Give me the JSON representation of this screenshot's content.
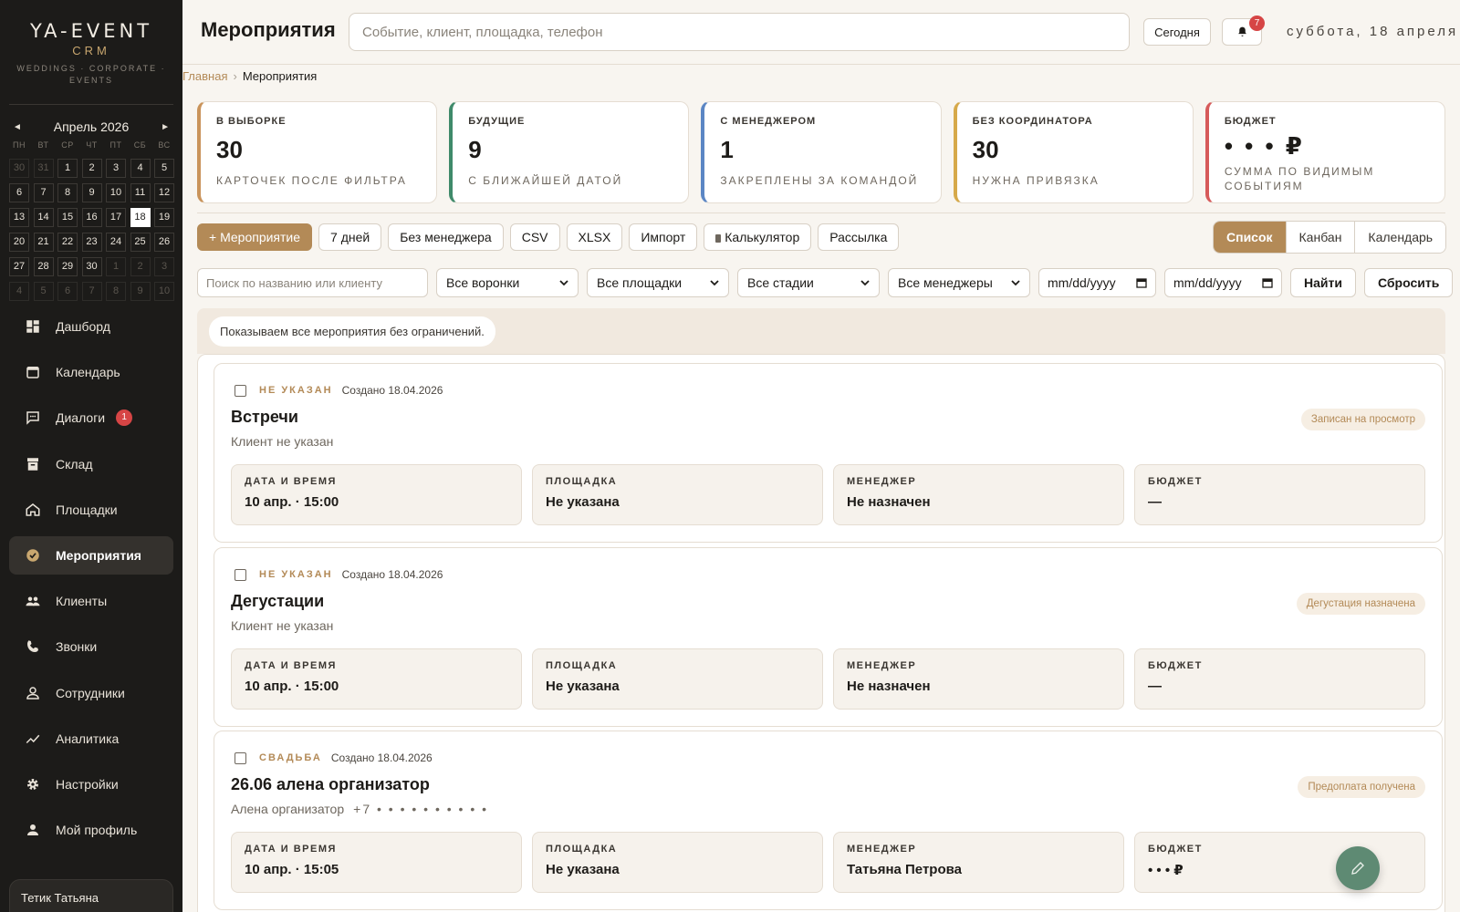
{
  "brand": {
    "name": "YA-EVENT",
    "sub": "CRM",
    "tagline": "WEDDINGS · CORPORATE · EVENTS"
  },
  "calendar": {
    "month": "Апрель 2026",
    "prev": "◄",
    "next": "►",
    "weekdays": [
      "ПН",
      "ВТ",
      "СР",
      "ЧТ",
      "ПТ",
      "СБ",
      "ВС"
    ],
    "weeks": [
      [
        "30",
        "31",
        "1",
        "2",
        "3",
        "4",
        "5"
      ],
      [
        "6",
        "7",
        "8",
        "9",
        "10",
        "11",
        "12"
      ],
      [
        "13",
        "14",
        "15",
        "16",
        "17",
        "18",
        "19"
      ],
      [
        "20",
        "21",
        "22",
        "23",
        "24",
        "25",
        "26"
      ],
      [
        "27",
        "28",
        "29",
        "30",
        "1",
        "2",
        "3"
      ],
      [
        "4",
        "5",
        "6",
        "7",
        "8",
        "9",
        "10"
      ]
    ]
  },
  "nav": [
    {
      "label": "Дашборд",
      "icon": "dashboard-icon"
    },
    {
      "label": "Календарь",
      "icon": "calendar-icon"
    },
    {
      "label": "Диалоги",
      "icon": "chat-icon",
      "badge": "1"
    },
    {
      "label": "Склад",
      "icon": "warehouse-icon"
    },
    {
      "label": "Площадки",
      "icon": "home-icon"
    },
    {
      "label": "Мероприятия",
      "icon": "check-circle-icon",
      "active": true
    },
    {
      "label": "Клиенты",
      "icon": "people-icon"
    },
    {
      "label": "Звонки",
      "icon": "phone-icon"
    },
    {
      "label": "Сотрудники",
      "icon": "person-outline-icon"
    },
    {
      "label": "Аналитика",
      "icon": "trend-icon"
    },
    {
      "label": "Настройки",
      "icon": "gear-icon"
    },
    {
      "label": "Мой профиль",
      "icon": "person-icon"
    }
  ],
  "user": {
    "name": "Тетик Татьяна"
  },
  "header": {
    "title": "Мероприятия",
    "search_placeholder": "Событие, клиент, площадка, телефон",
    "today": "Сегодня",
    "notifications": "7",
    "date": "суббота, 18 апреля"
  },
  "breadcrumb": {
    "home": "Главная",
    "sep": "›",
    "current": "Мероприятия"
  },
  "stats": [
    {
      "label": "В ВЫБОРКЕ",
      "value": "30",
      "sub": "КАРТОЧЕК ПОСЛЕ ФИЛЬТРА",
      "color": "#c9935a"
    },
    {
      "label": "БУДУЩИЕ",
      "value": "9",
      "sub": "С БЛИЖАЙШЕЙ ДАТОЙ",
      "color": "#3f8a6a"
    },
    {
      "label": "С МЕНЕДЖЕРОМ",
      "value": "1",
      "sub": "ЗАКРЕПЛЕНЫ ЗА КОМАНДОЙ",
      "color": "#5b86c4"
    },
    {
      "label": "БЕЗ КООРДИНАТОРА",
      "value": "30",
      "sub": "НУЖНА ПРИВЯЗКА",
      "color": "#d6a94a"
    },
    {
      "label": "БЮДЖЕТ",
      "value": "• • • ₽",
      "sub": "СУММА ПО ВИДИМЫМ СОБЫТИЯМ",
      "color": "#d65a5a"
    }
  ],
  "actions": {
    "add": "+ Мероприятие",
    "days7": "7 дней",
    "no_manager": "Без менеджера",
    "csv": "CSV",
    "xlsx": "XLSX",
    "import": "Импорт",
    "calculator": "Калькулятор",
    "mailing": "Рассылка"
  },
  "views": {
    "list": "Список",
    "kanban": "Канбан",
    "calendar": "Календарь"
  },
  "filters": {
    "search_placeholder": "Поиск по названию или клиенту",
    "funnels": "Все воронки",
    "venues": "Все площадки",
    "stages": "Все стадии",
    "managers": "Все менеджеры",
    "date_from": "mm/dd/yyyy",
    "date_to": "mm/dd/yyyy",
    "find": "Найти",
    "reset": "Сбросить"
  },
  "notice": "Показываем все мероприятия без ограничений.",
  "labels": {
    "datetime": "ДАТА И ВРЕМЯ",
    "venue": "ПЛОЩАДКА",
    "manager": "МЕНЕДЖЕР",
    "budget": "БЮДЖЕТ"
  },
  "events": [
    {
      "type": "НЕ УКАЗАН",
      "created": "Создано 18.04.2026",
      "title": "Встречи",
      "client": "Клиент не указан",
      "phone": "",
      "stage": "Записан на просмотр",
      "datetime": "10 апр. · 15:00",
      "venue": "Не указана",
      "manager": "Не назначен",
      "budget": "—"
    },
    {
      "type": "НЕ УКАЗАН",
      "created": "Создано 18.04.2026",
      "title": "Дегустации",
      "client": "Клиент не указан",
      "phone": "",
      "stage": "Дегустация назначена",
      "datetime": "10 апр. · 15:00",
      "venue": "Не указана",
      "manager": "Не назначен",
      "budget": "—"
    },
    {
      "type": "СВАДЬБА",
      "created": "Создано 18.04.2026",
      "title": "26.06 алена организатор",
      "client": "Алена организатор",
      "phone": "+7 • • • • • • • • • •",
      "stage": "Предоплата получена",
      "datetime": "10 апр. · 15:05",
      "venue": "Не указана",
      "manager": "Татьяна Петрова",
      "budget": "• • • ₽"
    }
  ]
}
